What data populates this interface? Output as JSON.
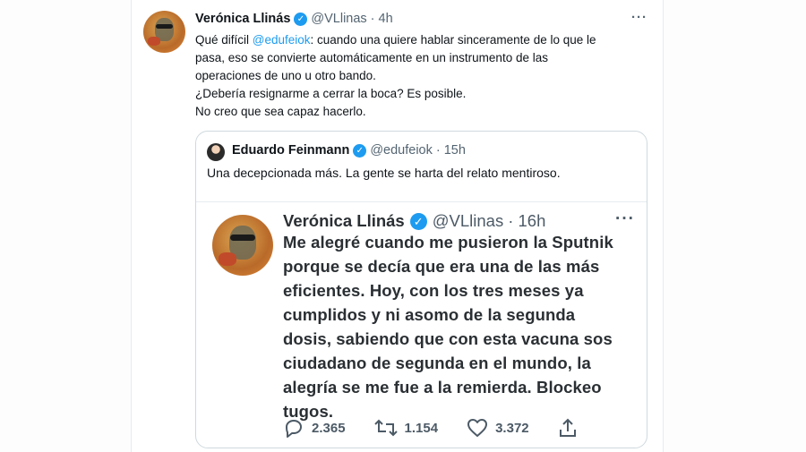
{
  "tweet": {
    "name": "Verónica Llinás",
    "handle": "@VLlinas",
    "time": "· 4h",
    "more": "···",
    "text": {
      "line1_a": "Qué difícil ",
      "line1_mention": "@edufeiok",
      "line1_b": ": cuando una quiere hablar sinceramente de lo que le",
      "line2": "pasa, eso se convierte automáticamente en un instrumento de las",
      "line3": "operaciones de uno u otro bando.",
      "line4": "¿Debería resignarme a cerrar la boca? Es posible.",
      "line5": "No creo que sea capaz hacerlo."
    }
  },
  "quote": {
    "name": "Eduardo Feinmann",
    "handle": "@edufeiok",
    "time": "· 15h",
    "text": "Una decepcionada más. La gente se harta del relato mentiroso.",
    "embedded": {
      "name": "Verónica Llinás",
      "handle": "@VLlinas",
      "time": "· 16h",
      "more": "···",
      "lines": [
        "Me alegré cuando me pusieron la Sputnik",
        "porque se decía que era una de las más",
        "eficientes. Hoy, con los tres meses ya",
        "cumplidos y ni asomo de la segunda",
        "dosis, sabiendo que con esta vacuna sos",
        "ciudadano de segunda en el mundo, la",
        "alegría se me fue a la remierda. Blockeo",
        "tugos."
      ],
      "actions": {
        "reply_count": "2.365",
        "retweet_count": "1.154",
        "like_count": "3.372"
      }
    }
  },
  "icons": {
    "verified": "verified-badge-icon",
    "reply": "reply-icon",
    "retweet": "retweet-icon",
    "like": "heart-icon",
    "share": "share-icon",
    "more": "more-options-icon"
  },
  "colors": {
    "verified": "#1d9bf0",
    "mention": "#1d9bf0",
    "secondary_text": "#536471",
    "border": "#cfd9de"
  }
}
